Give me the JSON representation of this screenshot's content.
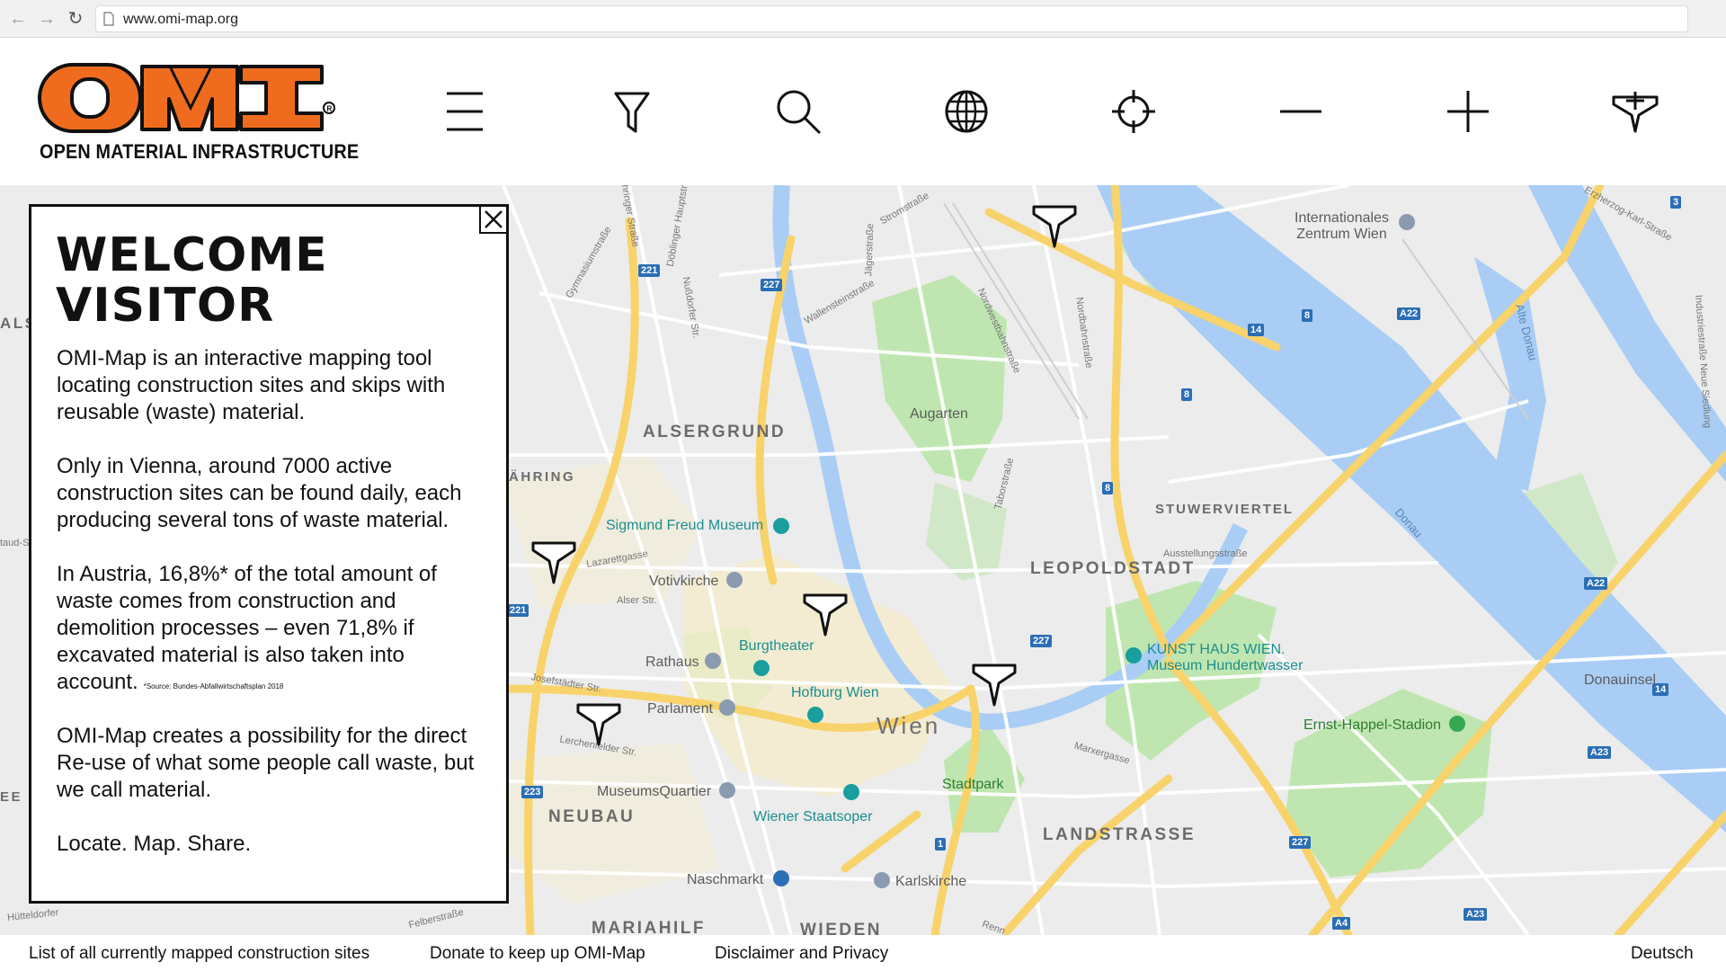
{
  "browser": {
    "url": "www.omi-map.org"
  },
  "logo": {
    "mark": "OMI",
    "subtitle": "OPEN MATERIAL INFRASTRUCTURE",
    "brand_color": "#ef6c1f"
  },
  "toolbar": {
    "icons": [
      "menu-icon",
      "filter-icon",
      "search-icon",
      "globe-icon",
      "locate-icon",
      "zoom-out-icon",
      "zoom-in-icon",
      "add-marker-icon"
    ]
  },
  "welcome": {
    "title_line1": "WELCOME",
    "title_line2": "VISITOR",
    "p1": "OMI-Map is an interactive mapping tool locating construction sites and skips with reusable (waste) material.",
    "p2": "Only in Vienna, around 7000 active construction sites can be found daily, each producing several tons of waste material.",
    "p3": "In Austria, 16,8%* of the total amount of waste comes from construction and demolition processes – even 71,8% if excavated material is also taken into account.",
    "p3_source": "*Source: Bundes-Abfallwirtschaftsplan 2018",
    "p4": "OMI-Map creates a possibility for the direct Re-use of what some people call waste, but we call material.",
    "p5": "Locate. Map. Share."
  },
  "map": {
    "districts": {
      "alsergrund": "ALSERGRUND",
      "leopoldstadt": "LEOPOLDSTADT",
      "neubau": "NEUBAU",
      "landstrasse": "LANDSTRASSE",
      "stuwerviertel": "STUWERVIERTEL",
      "mariahilf": "MARIAHILF",
      "wieden": "WIEDEN",
      "ahring": "ÄHRING",
      "als": "ALS",
      "ee": "EE"
    },
    "city": "Wien",
    "pois": {
      "augarten": "Augarten",
      "freud": "Sigmund Freud Museum",
      "votivkirche": "Votivkirche",
      "burgtheater": "Burgtheater",
      "rathaus": "Rathaus",
      "parlament": "Parlament",
      "hofburg": "Hofburg Wien",
      "museumsquartier": "MuseumsQuartier",
      "staatsoper": "Wiener Staatsoper",
      "naschmarkt": "Naschmarkt",
      "karlskirche": "Karlskirche",
      "stadtpark": "Stadtpark",
      "kunsthaus1": "KUNST HAUS WIEN.",
      "kunsthaus2": "Museum Hundertwasser",
      "happel": "Ernst-Happel-Stadion",
      "donauinsel": "Donauinsel",
      "vic1": "Internationales",
      "vic2": "Zentrum Wien"
    },
    "streets": {
      "alser": "Alser Str.",
      "lazarett": "Lazarettgasse",
      "josefstaedter": "Josefstädter Str.",
      "lerchenfelder": "Lerchenfelder Str.",
      "felber": "Felberstraße",
      "nussdorfer": "Nußdorfer Str.",
      "doeblinger": "Döblinger Hauptstraße",
      "gymnasium": "Gymnasiumstraße",
      "waehringer": "Währinger Straße",
      "jaeger": "Jägerstraße",
      "wallenstein": "Wallensteinstraße",
      "nordwestbahn": "Nordwestbahnstraße",
      "nordbahn": "Nordbahnstraße",
      "tabor": "Taborstraße",
      "ausstellung": "Ausstellungsstraße",
      "marxer": "Marxergasse",
      "erzherzog": "Erzherzog-Karl-Straße",
      "industrie": "Industriestraße Neue Siedlung",
      "donau": "Donau",
      "altedonau": "Alte Donau",
      "stroms": "Stromstraße",
      "hutteldorfer": "Hütteldorfer",
      "taud": "taud-Str",
      "renn": "Renn"
    },
    "shields": {
      "r221a": "221",
      "r221b": "221",
      "r227a": "227",
      "r227b": "227",
      "r227c": "227",
      "r223": "223",
      "r1": "1",
      "r8a": "8",
      "r8b": "8",
      "r8c": "8",
      "r14a": "14",
      "r14b": "14",
      "r3": "3",
      "a22a": "A22",
      "a22b": "A22",
      "a23a": "A23",
      "a23b": "A23",
      "a4": "A4"
    },
    "colors": {
      "water": "#a9cdf5",
      "park": "#bfe6b0",
      "major_road": "#f8d36b",
      "land": "#ececec"
    }
  },
  "footer": {
    "list_link": "List of all currently mapped construction sites",
    "donate_link": "Donate to keep up OMI-Map",
    "disclaimer_link": "Disclaimer and Privacy",
    "language": "Deutsch"
  }
}
